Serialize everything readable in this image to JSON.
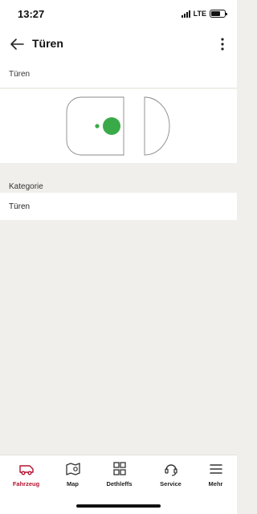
{
  "status_bar": {
    "time": "13:27",
    "network": "LTE",
    "signal_icon": "cellular-signal-icon",
    "battery_icon": "battery-icon",
    "battery_level": 0.7
  },
  "app_bar": {
    "title": "Türen",
    "back_icon": "arrow-left-icon",
    "more_icon": "vertical-ellipsis-icon"
  },
  "doors_section": {
    "header": "Türen",
    "status_color": "#3aaa48",
    "outline_color": "#8a8a8a"
  },
  "category": {
    "header": "Kategorie",
    "value": "Türen"
  },
  "tab_bar": {
    "active_color": "#b3122f",
    "tabs": [
      {
        "label": "Fahrzeug",
        "icon": "van-icon",
        "active": true
      },
      {
        "label": "Map",
        "icon": "map-pin-icon",
        "active": false
      },
      {
        "label": "Dethleffs",
        "icon": "grid-icon",
        "active": false
      },
      {
        "label": "Service",
        "icon": "headset-icon",
        "active": false
      },
      {
        "label": "Mehr",
        "icon": "menu-icon",
        "active": false
      }
    ]
  }
}
